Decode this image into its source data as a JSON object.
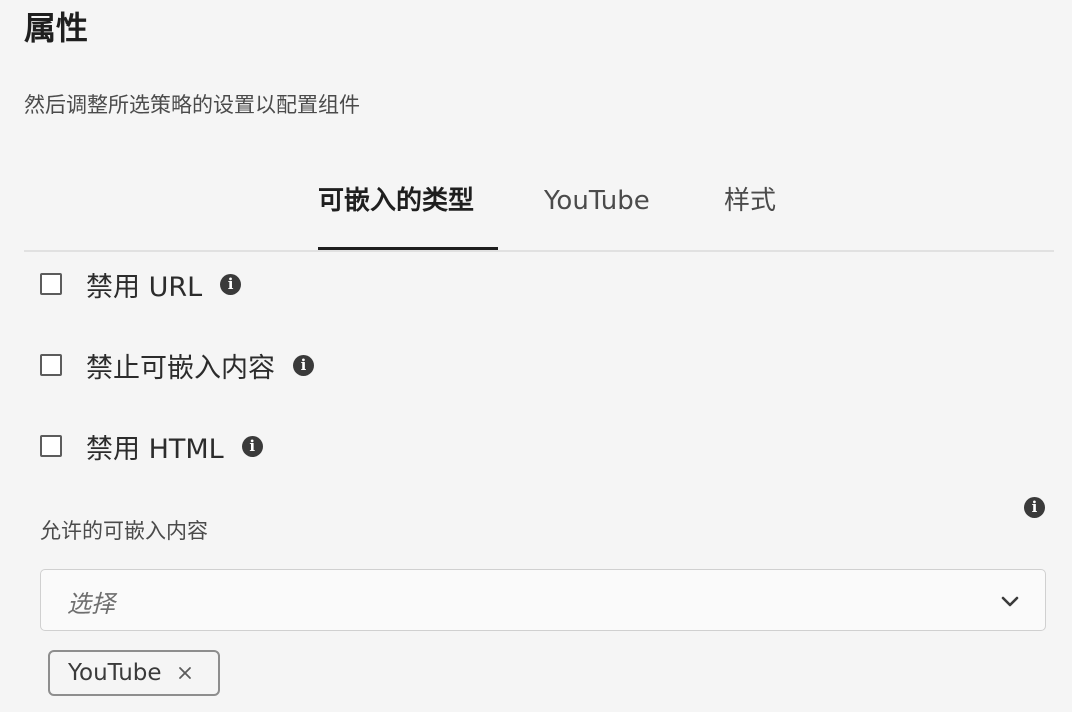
{
  "section": {
    "title": "属性",
    "description": "然后调整所选策略的设置以配置组件"
  },
  "tabs": [
    {
      "label": "可嵌入的类型",
      "active": true
    },
    {
      "label": "YouTube",
      "active": false
    },
    {
      "label": "样式",
      "active": false
    }
  ],
  "checkboxes": [
    {
      "label": "禁用 URL",
      "checked": false,
      "info_icon": "info-icon"
    },
    {
      "label": "禁止可嵌入内容",
      "checked": false,
      "info_icon": "info-icon"
    },
    {
      "label": "禁用 HTML",
      "checked": false,
      "info_icon": "info-icon"
    }
  ],
  "allowed_embeddables": {
    "label": "允许的可嵌入内容",
    "info_icon": "info-icon",
    "placeholder": "选择",
    "dropdown_icon": "chevron-down-icon",
    "selected_tags": [
      {
        "label": "YouTube",
        "remove_icon": "close-icon"
      }
    ]
  },
  "colors": {
    "background": "#f5f5f5",
    "text": "#2c2c2c",
    "active_tab_indicator": "#1f1f1f",
    "divider": "#e1e1e1"
  }
}
